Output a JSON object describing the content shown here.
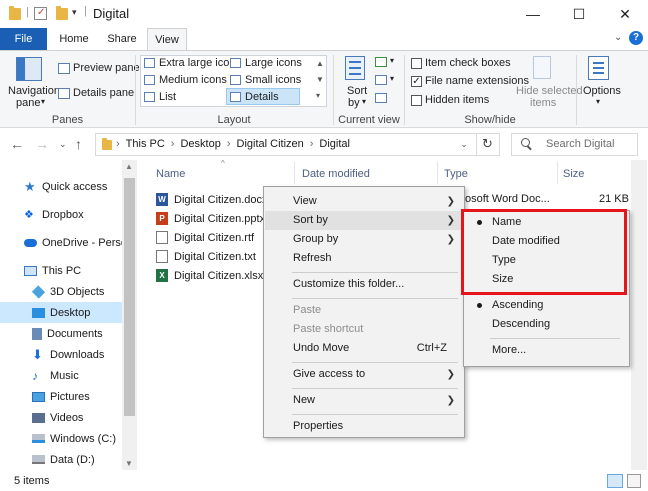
{
  "window": {
    "title": "Digital",
    "controls": {
      "minimize": "—",
      "maximize": "☐",
      "close": "✕"
    }
  },
  "tabs": [
    "File",
    "Home",
    "Share",
    "View"
  ],
  "ribbon": {
    "panes": {
      "navigation_pane": "Navigation",
      "navigation_pane_2": "pane",
      "preview_pane": "Preview pane",
      "details_pane": "Details pane",
      "label": "Panes"
    },
    "layout": {
      "items": [
        "Extra large icons",
        "Large icons",
        "Medium icons",
        "Small icons",
        "List",
        "Details"
      ],
      "label": "Layout"
    },
    "current_view": {
      "sort_by": "Sort",
      "sort_by_2": "by",
      "label": "Current view"
    },
    "show_hide": {
      "item_check_boxes": "Item check boxes",
      "file_name_extensions": "File name extensions",
      "hidden_items": "Hidden items",
      "hide_selected": "Hide selected",
      "hide_selected_2": "items",
      "label": "Show/hide"
    },
    "options": "Options"
  },
  "address": {
    "crumbs": [
      "This PC",
      "Desktop",
      "Digital Citizen",
      "Digital"
    ],
    "search_placeholder": "Search Digital"
  },
  "nav": [
    {
      "label": "Quick access"
    },
    {
      "label": "Dropbox"
    },
    {
      "label": "OneDrive - Person"
    },
    {
      "label": "This PC"
    },
    {
      "label": "3D Objects"
    },
    {
      "label": "Desktop"
    },
    {
      "label": "Documents"
    },
    {
      "label": "Downloads"
    },
    {
      "label": "Music"
    },
    {
      "label": "Pictures"
    },
    {
      "label": "Videos"
    },
    {
      "label": "Windows (C:)"
    },
    {
      "label": "Data (D:)"
    }
  ],
  "columns": {
    "name": "Name",
    "date": "Date modified",
    "type": "Type",
    "size": "Size"
  },
  "files": [
    {
      "name": "Digital Citizen.docx",
      "type_fragment": "osoft Word Doc...",
      "size": "21 KB"
    },
    {
      "name": "Digital Citizen.pptx"
    },
    {
      "name": "Digital Citizen.rtf"
    },
    {
      "name": "Digital Citizen.txt"
    },
    {
      "name": "Digital Citizen.xlsx"
    }
  ],
  "context_menu": {
    "view": "View",
    "sort_by": "Sort by",
    "group_by": "Group by",
    "refresh": "Refresh",
    "customize": "Customize this folder...",
    "paste": "Paste",
    "paste_shortcut": "Paste shortcut",
    "undo_move": "Undo Move",
    "undo_shortcut": "Ctrl+Z",
    "give_access": "Give access to",
    "new": "New",
    "properties": "Properties"
  },
  "sort_submenu": {
    "name": "Name",
    "date_modified": "Date modified",
    "type": "Type",
    "size": "Size",
    "ascending": "Ascending",
    "descending": "Descending",
    "more": "More..."
  },
  "status": {
    "count": "5 items"
  },
  "colors": {
    "accent": "#1a5fb4",
    "highlight": "#e8141b",
    "selection": "#cce8ff"
  }
}
